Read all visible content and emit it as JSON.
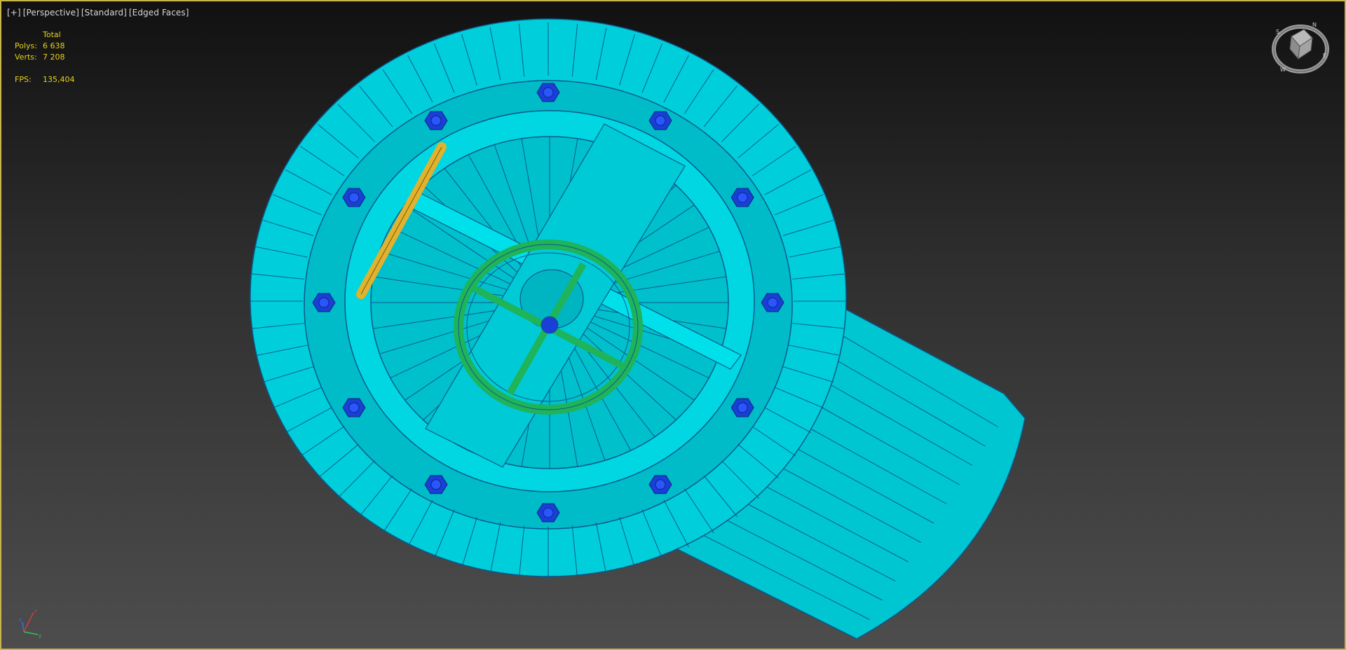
{
  "viewport": {
    "label_parts": [
      "[+]",
      "[Perspective]",
      "[Standard]",
      "[Edged Faces]"
    ],
    "border_color": "#c8b64a"
  },
  "stats": {
    "header": "Total",
    "rows": [
      {
        "key": "Polys:",
        "value": "6 638"
      },
      {
        "key": "Verts:",
        "value": "7 208"
      }
    ],
    "fps_key": "FPS:",
    "fps_value": "135,404",
    "color": "#e8d21a"
  },
  "scene": {
    "body_color": "#00d2dc",
    "wire_color": "#0a5a8c",
    "bolt_color": "#1a3fd6",
    "wheel_color": "#1fb35a",
    "rod_color": "#e0b22e"
  },
  "viewcube": {
    "compass_labels": [
      "N",
      "E",
      "S",
      "W"
    ]
  },
  "axis_tripod": {
    "labels": [
      "x",
      "y",
      "z"
    ]
  }
}
